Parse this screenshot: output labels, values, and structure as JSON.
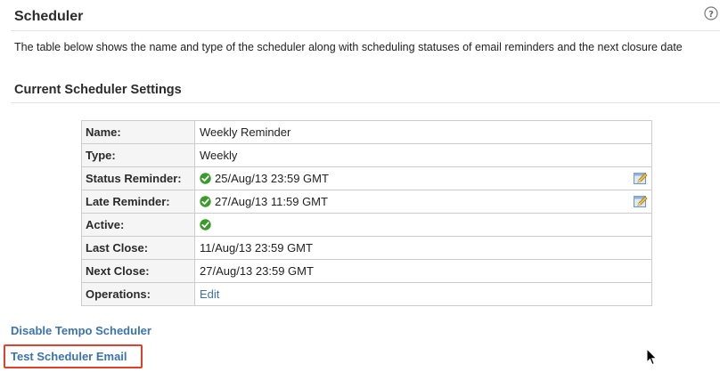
{
  "header": {
    "title": "Scheduler",
    "help_icon": "question-mark-circle-icon"
  },
  "description": "The table below shows the name and type of the scheduler along with scheduling statuses of email reminders and the next closure date",
  "section": {
    "title": "Current Scheduler Settings"
  },
  "settings": {
    "name": {
      "label": "Name:",
      "value": "Weekly Reminder"
    },
    "type": {
      "label": "Type:",
      "value": "Weekly"
    },
    "status_reminder": {
      "label": "Status Reminder:",
      "value": "25/Aug/13 23:59 GMT",
      "icon": "green-check-icon",
      "action_icon": "edit-pencil-icon"
    },
    "late_reminder": {
      "label": "Late Reminder:",
      "value": "27/Aug/13 11:59 GMT",
      "icon": "green-check-icon",
      "action_icon": "edit-pencil-icon"
    },
    "active": {
      "label": "Active:",
      "icon": "green-check-icon"
    },
    "last_close": {
      "label": "Last Close:",
      "value": "11/Aug/13 23:59 GMT"
    },
    "next_close": {
      "label": "Next Close:",
      "value": "27/Aug/13 23:59 GMT"
    },
    "operations": {
      "label": "Operations:",
      "link": "Edit"
    }
  },
  "links": {
    "disable": "Disable Tempo Scheduler",
    "test": "Test Scheduler Email"
  },
  "colors": {
    "link": "#3b73af",
    "label_bg": "#f5f5f5",
    "border": "#cccccc",
    "highlight_box": "#e0412b",
    "check": "#3a9a2a"
  }
}
